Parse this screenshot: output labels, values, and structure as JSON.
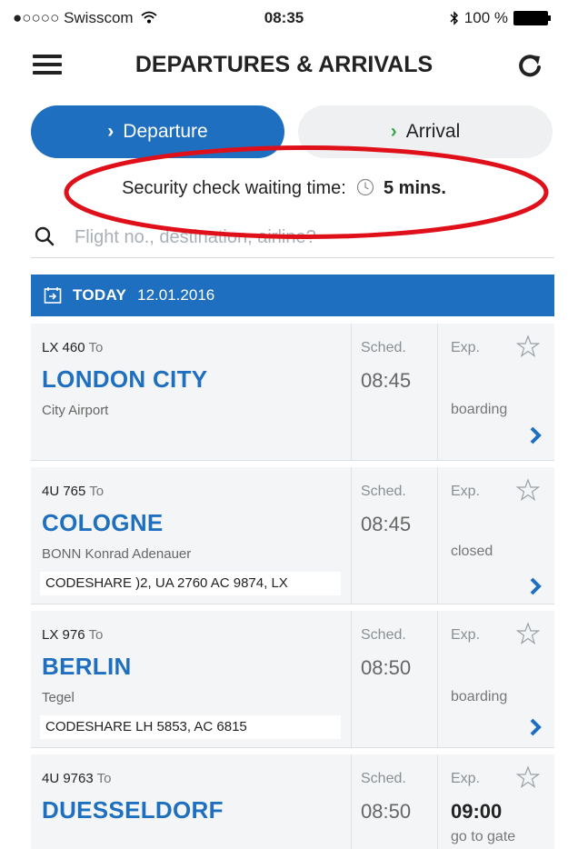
{
  "status_bar": {
    "carrier": "●○○○○ Swisscom",
    "time": "08:35",
    "battery": "100 %"
  },
  "header": {
    "title": "DEPARTURES & ARRIVALS"
  },
  "tabs": {
    "departure": "Departure",
    "arrival": "Arrival"
  },
  "security": {
    "label": "Security check waiting time:",
    "value": "5 mins."
  },
  "search": {
    "placeholder": "Flight no., destination, airline?"
  },
  "date_bar": {
    "today_label": "TODAY",
    "date": "12.01.2016"
  },
  "column_headers": {
    "sched": "Sched.",
    "exp": "Exp."
  },
  "flights": [
    {
      "number": "LX 460",
      "to": "To",
      "destination": "LONDON CITY",
      "airport": "City Airport",
      "codeshare": "",
      "sched": "08:45",
      "exp": "",
      "status": "boarding"
    },
    {
      "number": "4U 765",
      "to": "To",
      "destination": "COLOGNE",
      "airport": "BONN Konrad Adenauer",
      "codeshare": "CODESHARE )2, UA 2760   AC 9874, LX",
      "sched": "08:45",
      "exp": "",
      "status": "closed"
    },
    {
      "number": "LX 976",
      "to": "To",
      "destination": "BERLIN",
      "airport": "Tegel",
      "codeshare": "CODESHARE  LH 5853, AC 6815",
      "sched": "08:50",
      "exp": "",
      "status": "boarding"
    },
    {
      "number": "4U 9763",
      "to": "To",
      "destination": "DUESSELDORF",
      "airport": "",
      "codeshare": "",
      "sched": "08:50",
      "exp": "09:00",
      "status": "go to gate"
    }
  ],
  "colors": {
    "brand_blue": "#1e6fc0",
    "highlight_red": "#e0101a",
    "arrival_chevron": "#3aa64a"
  },
  "icons": [
    "wifi-icon",
    "bluetooth-icon",
    "battery-icon",
    "menu-icon",
    "refresh-icon",
    "clock-icon",
    "search-icon",
    "calendar-icon",
    "star-icon",
    "chevron-right-icon"
  ]
}
